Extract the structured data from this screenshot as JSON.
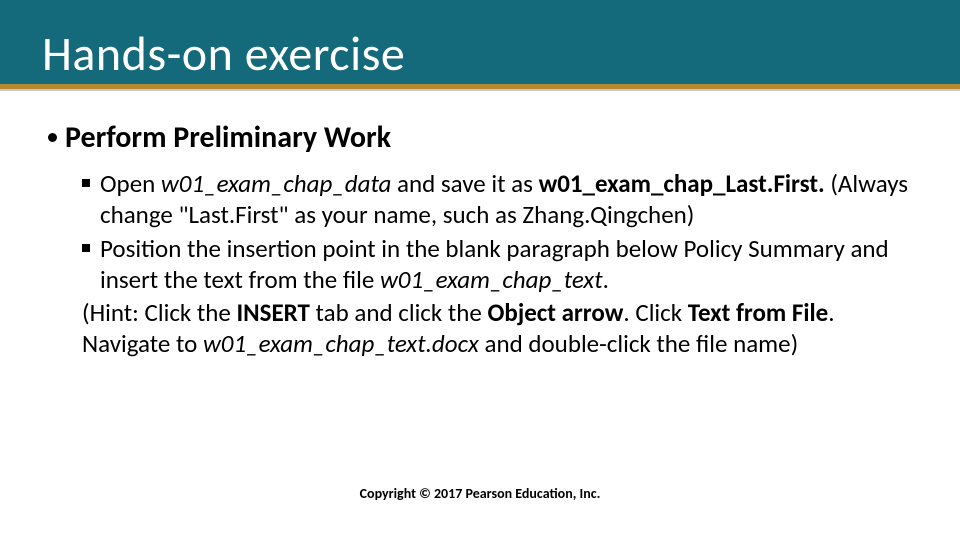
{
  "title": "Hands-on exercise",
  "heading": "Perform Preliminary Work",
  "item1": {
    "pre": "Open ",
    "file_in": "w01_exam_chap_data",
    "mid": " and save it as ",
    "file_out": "w01_exam_chap_Last.First.",
    "post": " (Always change \"Last.First\" as your name, such as Zhang.Qingchen)"
  },
  "item2": {
    "pre": "Position the insertion point in the blank paragraph below Policy Summary and insert the text from the file ",
    "file": "w01_exam_chap_text",
    "post": "."
  },
  "hint": {
    "open": "(Hint: Click the ",
    "b1": "INSERT",
    "t1": " tab and click the ",
    "b2": "Object arrow",
    "t2": ". Click ",
    "b3": "Text from File",
    "t3": ". Navigate to ",
    "file": "w01_exam_chap_text.docx",
    "t4": " and double-click the file name)"
  },
  "footer": "Copyright © 2017 Pearson Education, Inc."
}
